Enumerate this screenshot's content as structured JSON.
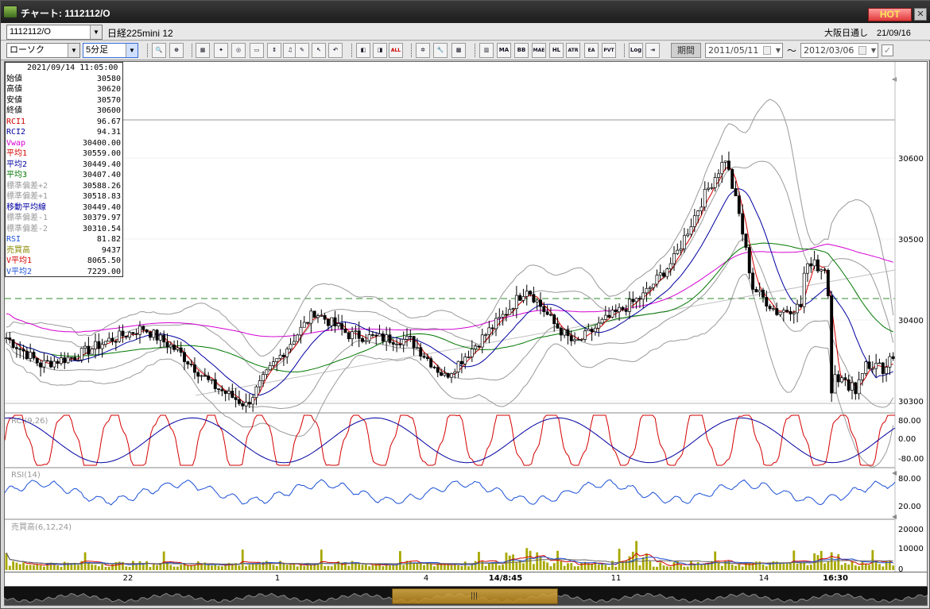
{
  "window": {
    "title": "チャート: 1112112/O",
    "hot": "HOT",
    "close": "✕"
  },
  "toolbar": {
    "symbol": "1112112/O",
    "instrument": "日経225mini 12",
    "session": "大阪日通し　21/09/16",
    "chart_type": "ローソク",
    "interval": "5分足",
    "period_label": "期間",
    "date_from": "2011/05/11",
    "date_to": "2012/03/06",
    "tilde": "〜"
  },
  "tools": [
    {
      "name": "zoom-icon",
      "label": "🔍"
    },
    {
      "name": "zoom-range-icon",
      "label": "⊕"
    },
    {
      "name": "grid-icon",
      "label": "▦"
    },
    {
      "name": "crosshair-candle-icon",
      "label": "✦"
    },
    {
      "name": "zoom-chart-icon",
      "label": "◎"
    },
    {
      "name": "chart-window-icon",
      "label": "▭"
    },
    {
      "name": "candle-arrow-icon",
      "label": "↕"
    },
    {
      "name": "sound-icon",
      "label": "♫"
    },
    {
      "name": "pencil-icon",
      "label": "✎"
    },
    {
      "name": "cursor-icon",
      "label": "↖"
    },
    {
      "name": "undo-icon",
      "label": "↶"
    },
    {
      "name": "candle-left-icon",
      "label": "◧"
    },
    {
      "name": "candle-right-icon",
      "label": "◨"
    },
    {
      "name": "all-label",
      "label": "ALL"
    },
    {
      "name": "settings-icon",
      "label": "✲"
    },
    {
      "name": "wrench-icon",
      "label": "🔧"
    },
    {
      "name": "palette-icon",
      "label": "▩"
    },
    {
      "name": "multi-chart-icon",
      "label": "▥"
    },
    {
      "name": "ma-label",
      "label": "MA"
    },
    {
      "name": "bb-label",
      "label": "BB"
    },
    {
      "name": "mae-label",
      "label": "MAE"
    },
    {
      "name": "hl-label",
      "label": "HL"
    },
    {
      "name": "atr-label",
      "label": "ATR"
    },
    {
      "name": "ea-label",
      "label": "EA"
    },
    {
      "name": "pvt-label",
      "label": "PVT"
    },
    {
      "name": "log-label",
      "label": "Log"
    },
    {
      "name": "export-icon",
      "label": "⇥"
    }
  ],
  "datapanel": {
    "timestamp": "2021/09/14 11:05:00",
    "rows": [
      {
        "k": "始値",
        "v": "30580",
        "c": "#000"
      },
      {
        "k": "高値",
        "v": "30620",
        "c": "#000"
      },
      {
        "k": "安値",
        "v": "30570",
        "c": "#000"
      },
      {
        "k": "終値",
        "v": "30600",
        "c": "#000"
      },
      {
        "k": "RCI1",
        "v": "96.67",
        "c": "#d40000"
      },
      {
        "k": "RCI2",
        "v": "94.31",
        "c": "#0000a0"
      },
      {
        "k": "Vwap",
        "v": "30400.00",
        "c": "#d400d4"
      },
      {
        "k": "平均1",
        "v": "30559.00",
        "c": "#d40000"
      },
      {
        "k": "平均2",
        "v": "30449.40",
        "c": "#0000a0"
      },
      {
        "k": "平均3",
        "v": "30407.40",
        "c": "#007700"
      },
      {
        "k": "標準偏差+2",
        "v": "30588.26",
        "c": "#9a9a9a"
      },
      {
        "k": "標準偏差+1",
        "v": "30518.83",
        "c": "#9a9a9a"
      },
      {
        "k": "移動平均線",
        "v": "30449.40",
        "c": "#0000a0"
      },
      {
        "k": "標準偏差-1",
        "v": "30379.97",
        "c": "#9a9a9a"
      },
      {
        "k": "標準偏差-2",
        "v": "30310.54",
        "c": "#9a9a9a"
      },
      {
        "k": "RSI",
        "v": "81.82",
        "c": "#1a4fd6"
      },
      {
        "k": "売買高",
        "v": "9437",
        "c": "#8a8a00"
      },
      {
        "k": "V平均1",
        "v": "8065.50",
        "c": "#d40000"
      },
      {
        "k": "V平均2",
        "v": "7229.00",
        "c": "#1a4fd6"
      }
    ]
  },
  "price_axis": [
    "30600",
    "30500",
    "30400",
    "30300"
  ],
  "panels": {
    "rci_label": "RCI(9,26)",
    "rci_ticks": [
      "80.00",
      "0.00",
      "-80.00"
    ],
    "rsi_label": "RSI(14)",
    "rsi_ticks": [
      "80.00",
      "20.00"
    ],
    "vol_label": "売買高(6,12,24)",
    "vol_ticks": [
      "20000",
      "10000",
      "0"
    ]
  },
  "time_axis": [
    "22",
    "1",
    "4",
    "14/8:45",
    "11",
    "14",
    "16:30"
  ],
  "colors": {
    "rci1": "#d40000",
    "rci2": "#0000a0",
    "rsi": "#1a4fd6",
    "vol": "#a8a800",
    "vwap": "#d400d4",
    "ma1": "#d40000",
    "ma2": "#0000a0",
    "ma3": "#007700",
    "band": "#9a9a9a"
  }
}
